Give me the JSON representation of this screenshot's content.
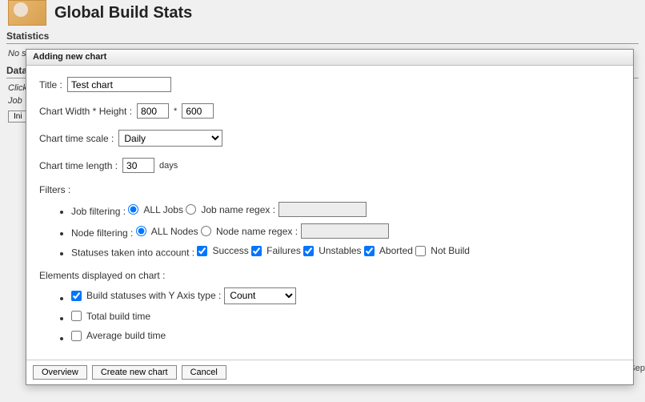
{
  "header": {
    "title": "Global Build Stats"
  },
  "sections": {
    "statistics": "Statistics",
    "no_stat": "No s",
    "data": "Data",
    "click_text": "Click",
    "job_text": "Job",
    "init_button": "Ini"
  },
  "dialog": {
    "title": "Adding new chart",
    "labels": {
      "title": "Title :",
      "width_height": "Chart Width * Height :",
      "times": "*",
      "time_scale": "Chart time scale :",
      "time_length": "Chart time length :",
      "days": "days",
      "filters": "Filters :",
      "job_filtering": "Job filtering :",
      "all_jobs": "ALL Jobs",
      "job_name_regex": "Job name regex :",
      "node_filtering": "Node filtering :",
      "all_nodes": "ALL Nodes",
      "node_name_regex": "Node name regex :",
      "statuses_label": "Statuses taken into account :",
      "success": "Success",
      "failures": "Failures",
      "unstables": "Unstables",
      "aborted": "Aborted",
      "not_build": "Not Build",
      "elements": "Elements displayed on chart :",
      "build_statuses": "Build statuses with Y Axis type :",
      "total_build_time": "Total build time",
      "avg_build_time": "Average build time"
    },
    "values": {
      "title": "Test chart",
      "width": "800",
      "height": "600",
      "time_scale": "Daily",
      "time_length": "30",
      "yaxis_type": "Count"
    },
    "buttons": {
      "overview": "Overview",
      "create": "Create new chart",
      "cancel": "Cancel"
    }
  },
  "footer": {
    "generated": "Page generated: Sep"
  }
}
